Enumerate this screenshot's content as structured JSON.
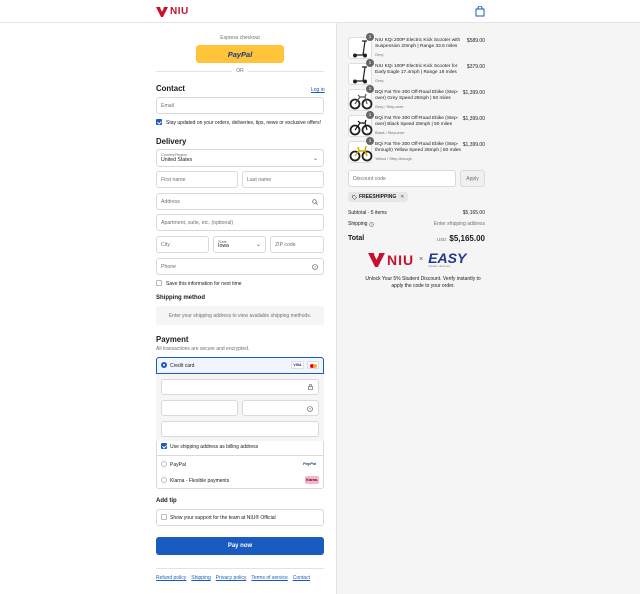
{
  "header": {
    "brand": "NIU"
  },
  "express": {
    "label": "Express checkout",
    "paypal": "PayPal",
    "or": "OR"
  },
  "contact": {
    "title": "Contact",
    "login": "Log in",
    "email_placeholder": "Email",
    "news_label": "Stay updated on your orders, deliveries, tips, news or exclusive offers!"
  },
  "delivery": {
    "title": "Delivery",
    "country_label": "Country/Region",
    "country_value": "United States",
    "first_name": "First name",
    "last_name": "Last name",
    "address": "Address",
    "apartment": "Apartment, suite, etc. (optional)",
    "city": "City",
    "state_label": "State",
    "state_value": "Iowa",
    "zip": "ZIP code",
    "phone": "Phone",
    "save_label": "Save this information for next time"
  },
  "shipping": {
    "title": "Shipping method",
    "notice": "Enter your shipping address to view available shipping methods."
  },
  "payment": {
    "title": "Payment",
    "subtitle": "All transactions are secure and encrypted.",
    "credit_card": "Credit card",
    "visa": "VISA",
    "billing_label": "Use shipping address as billing address",
    "paypal": "PayPal",
    "paypal_logo": "PayPal",
    "klarna": "Klarna - Flexible payments",
    "klarna_logo": "Klarna."
  },
  "tip": {
    "title": "Add tip",
    "label": "Show your support for the team at NIU® Official"
  },
  "pay_button": "Pay now",
  "footer": {
    "links": [
      "Refund policy",
      "Shipping",
      "Privacy policy",
      "Terms of service",
      "Contact"
    ]
  },
  "order": {
    "items": [
      {
        "qty": "1",
        "title": "NIU KQi 200P Electric Kick Scooter with Suspension 20mph | Range 33.6 miles",
        "variant": "Grey",
        "price": "$589.00",
        "icon": "scooter-icon"
      },
      {
        "qty": "1",
        "title": "NIU KQi 100P Electric Kick Scooter for Early Eagle 17.4mph | Range 18 miles",
        "variant": "Grey",
        "price": "$379.00",
        "icon": "scooter-icon"
      },
      {
        "qty": "1",
        "title": "BQi Fat Tire 300 Off-Road Ebike (Step-over) Grey Speed 28mph | 50 miles",
        "variant": "Grey / Step-over",
        "price": "$1,399.00",
        "icon": "ebike-icon"
      },
      {
        "qty": "1",
        "title": "BQi Fat Tire 300 Off-Road Ebike (Step-over) Black Speed 28mph | 50 miles",
        "variant": "Black / Step-over",
        "price": "$1,399.00",
        "icon": "ebike-icon"
      },
      {
        "qty": "1",
        "title": "BQi Fat Tire 300 Off-Road Ebike (Step-through) Yellow Speed 28mph | 50 miles",
        "variant": "Yellow / Step-through",
        "price": "$1,399.00",
        "icon": "ebike-icon"
      }
    ],
    "discount_placeholder": "Discount code",
    "apply": "Apply",
    "code_tag": "FREESHIPPING",
    "subtotal_label": "Subtotal · 5 items",
    "subtotal_value": "$5,165.00",
    "shipping_label": "Shipping",
    "shipping_value": "Enter shipping address",
    "total_label": "Total",
    "currency": "USD",
    "total_value": "$5,165.00",
    "promo_partner": "EASY",
    "promo_partner_sub": "student discount",
    "promo_text": "Unlock Your 5% Student Discount. Verify instantly to apply the code to your order."
  },
  "colors": {
    "accent": "#1a5bc2",
    "brand_red": "#c8102e",
    "paypal_yellow": "#ffc439",
    "klarna_pink": "#ffb3c7"
  }
}
